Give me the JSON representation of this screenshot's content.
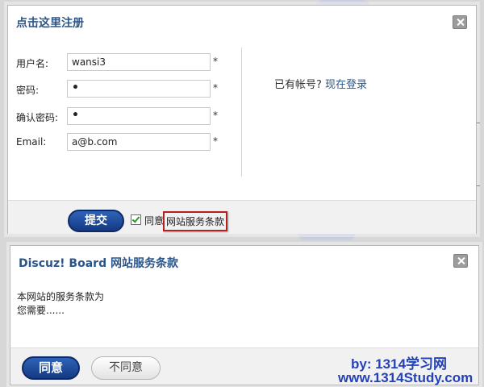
{
  "register": {
    "title": "点击这里注册",
    "fields": [
      {
        "label": "用户名:",
        "value": "wansi3",
        "required": "*"
      },
      {
        "label": "密码:",
        "value": "•",
        "required": "*"
      },
      {
        "label": "确认密码:",
        "value": "•",
        "required": "*"
      },
      {
        "label": "Email:",
        "value": "a@b.com",
        "required": "*"
      }
    ],
    "login_prompt": "已有帐号?",
    "login_link": "现在登录",
    "submit_label": "提交",
    "agree_checked": true,
    "agree_label": "同意",
    "terms_link": "网站服务条款"
  },
  "terms": {
    "title": "Discuz! Board 网站服务条款",
    "body_line1": "本网站的服务条款为",
    "body_line2": "您需要......",
    "agree_label": "同意",
    "disagree_label": "不同意"
  },
  "watermark": {
    "line1": "by: 1314学习网",
    "line2": "www.1314Study.com"
  },
  "colors": {
    "title": "#2b5589",
    "primary_button": "#1f4a9c",
    "terms_highlight": "#b52020",
    "watermark": "#2442b8"
  }
}
